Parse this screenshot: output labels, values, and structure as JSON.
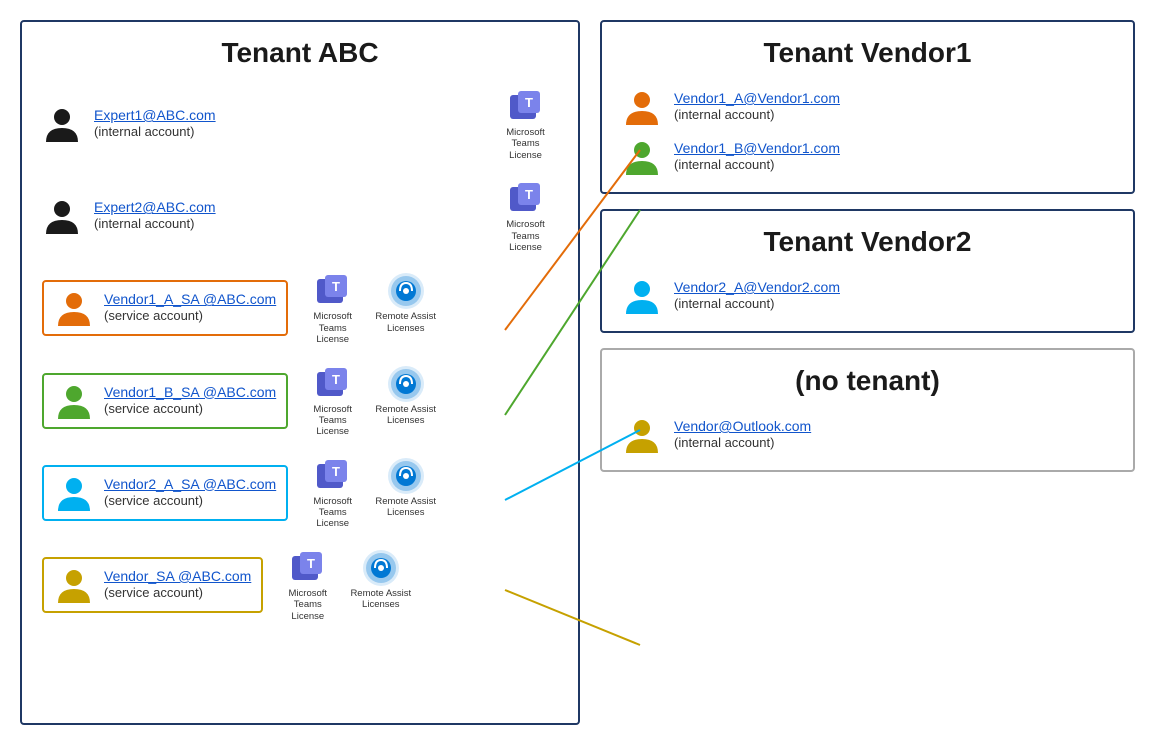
{
  "tenantABC": {
    "title": "Tenant ABC",
    "users": [
      {
        "id": "expert1",
        "email": "Expert1@ABC.com",
        "type": "(internal account)",
        "color": "#1a1a1a",
        "licenses": [
          "teams"
        ]
      },
      {
        "id": "expert2",
        "email": "Expert2@ABC.com",
        "type": "(internal account)",
        "color": "#1a1a1a",
        "licenses": [
          "teams"
        ]
      },
      {
        "id": "vendor1-a-sa",
        "email": "Vendor1_A_SA @ABC.com",
        "type": "(service account)",
        "color": "#e36c09",
        "boxColor": "orange",
        "licenses": [
          "teams",
          "remoteassist"
        ]
      },
      {
        "id": "vendor1-b-sa",
        "email": "Vendor1_B_SA @ABC.com",
        "type": "(service account)",
        "color": "#4ea72e",
        "boxColor": "green",
        "licenses": [
          "teams",
          "remoteassist"
        ]
      },
      {
        "id": "vendor2-a-sa",
        "email": "Vendor2_A_SA @ABC.com",
        "type": "(service account)",
        "color": "#00b0f0",
        "boxColor": "cyan",
        "licenses": [
          "teams",
          "remoteassist"
        ]
      },
      {
        "id": "vendor-sa",
        "email": "Vendor_SA @ABC.com",
        "type": "(service account)",
        "color": "#c6a100",
        "boxColor": "gold",
        "licenses": [
          "teams",
          "remoteassist"
        ]
      }
    ]
  },
  "tenantVendor1": {
    "title": "Tenant Vendor1",
    "users": [
      {
        "id": "vendor1-a",
        "email": "Vendor1_A@Vendor1.com",
        "type": "(internal account)",
        "color": "#e36c09"
      },
      {
        "id": "vendor1-b",
        "email": "Vendor1_B@Vendor1.com",
        "type": "(internal account)",
        "color": "#4ea72e"
      }
    ]
  },
  "tenantVendor2": {
    "title": "Tenant Vendor2",
    "users": [
      {
        "id": "vendor2-a",
        "email": "Vendor2_A@Vendor2.com",
        "type": "(internal account)",
        "color": "#00b0f0"
      }
    ]
  },
  "noTenant": {
    "title": "(no tenant)",
    "users": [
      {
        "id": "vendor-outlook",
        "email": "Vendor@Outlook.com",
        "type": "(internal account)",
        "color": "#c6a100"
      }
    ]
  },
  "labels": {
    "teamsLicense": "Microsoft Teams License",
    "remoteAssist": "Remote Assist Licenses",
    "internalAccount": "(internal account)",
    "serviceAccount": "(service account)"
  }
}
